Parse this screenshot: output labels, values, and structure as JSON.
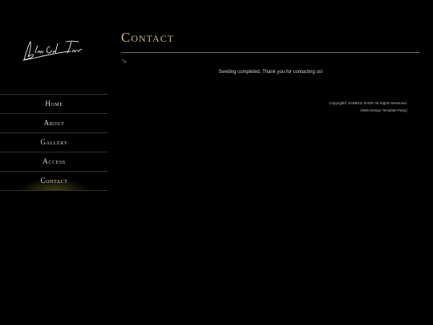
{
  "brand": {
    "logo_text": "Black Cat Team",
    "icon": "signature-logo"
  },
  "nav": {
    "items": [
      {
        "label": "Home",
        "active": false
      },
      {
        "label": "About",
        "active": false
      },
      {
        "label": "Gallery",
        "active": false
      },
      {
        "label": "Access",
        "active": false
      },
      {
        "label": "Contact",
        "active": true
      }
    ]
  },
  "main": {
    "title": "Contact",
    "stray_mark": "\">",
    "message": "Sending completed. Thank you for contacting us!"
  },
  "footer": {
    "copyright": "Copyright© SAMPLE SHOP All Rights Reserved.",
    "credit": "(Web Design Template Party)"
  },
  "colors": {
    "background": "#000000",
    "title_gold": "#c9b57a",
    "nav_text": "#d9d4c4",
    "divider": "#2f2f2f",
    "active_glow": "#786e28"
  }
}
